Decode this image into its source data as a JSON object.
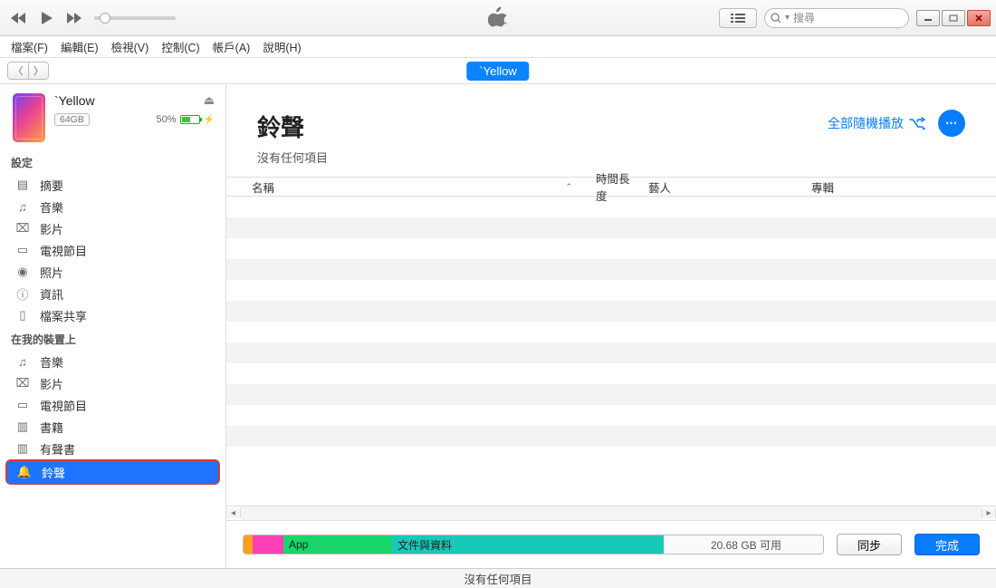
{
  "toolbar": {
    "search_placeholder": "搜尋"
  },
  "menubar": [
    "檔案(F)",
    "編輯(E)",
    "檢視(V)",
    "控制(C)",
    "帳戶(A)",
    "說明(H)"
  ],
  "device": {
    "chip_name": "`Yellow",
    "name": "`Yellow",
    "capacity": "64GB",
    "battery_pct": "50%"
  },
  "sidebar": {
    "section1_label": "設定",
    "settings": [
      "摘要",
      "音樂",
      "影片",
      "電視節目",
      "照片",
      "資訊",
      "檔案共享"
    ],
    "section2_label": "在我的裝置上",
    "ondevice": [
      "音樂",
      "影片",
      "電視節目",
      "書籍",
      "有聲書",
      "鈴聲"
    ]
  },
  "main": {
    "title": "鈴聲",
    "subtitle": "沒有任何項目",
    "shuffle_label": "全部隨機播放",
    "cols": {
      "name": "名稱",
      "length": "時間長度",
      "artist": "藝人",
      "album": "專輯"
    }
  },
  "storage": {
    "app_label": "App",
    "docs_label": "文件與資料",
    "free_label": "20.68 GB 可用"
  },
  "buttons": {
    "sync": "同步",
    "done": "完成"
  },
  "statusbar": "沒有任何項目"
}
